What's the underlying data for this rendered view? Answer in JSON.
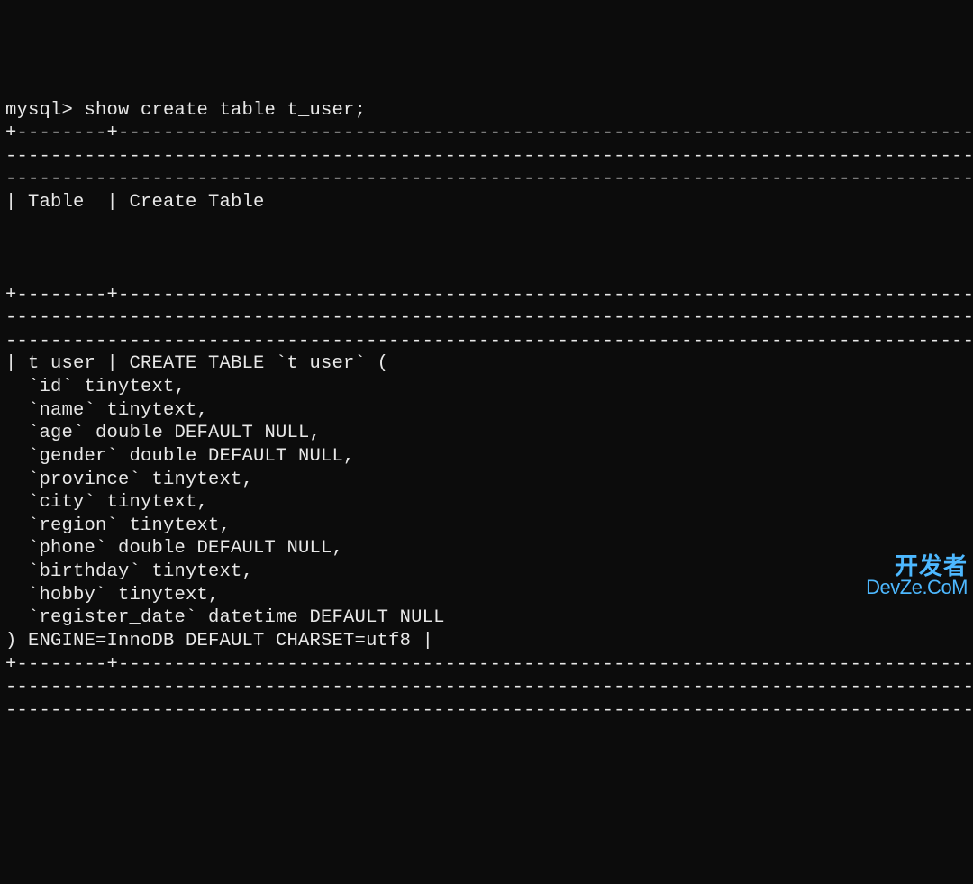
{
  "terminal": {
    "prompt": "mysql> ",
    "command": "show create table t_user;",
    "separator1": "+--------+--------------------------------------------------------------------------------------",
    "separator2": "--------------------------------------------------------------------------------------------",
    "separator3": "-----------------------------------------------------------------------------------------+",
    "header_row": "| Table  | Create Table",
    "header_end": "                                                                                         |",
    "data_line1": "| t_user | CREATE TABLE `t_user` (",
    "col_id": "  `id` tinytext,",
    "col_name": "  `name` tinytext,",
    "col_age": "  `age` double DEFAULT NULL,",
    "col_gender": "  `gender` double DEFAULT NULL,",
    "col_province": "  `province` tinytext,",
    "col_city": "  `city` tinytext,",
    "col_region": "  `region` tinytext,",
    "col_phone": "  `phone` double DEFAULT NULL,",
    "col_birthday": "  `birthday` tinytext,",
    "col_hobby": "  `hobby` tinytext,",
    "col_register": "  `register_date` datetime DEFAULT NULL",
    "data_end": ") ENGINE=InnoDB DEFAULT CHARSET=utf8 |"
  },
  "watermark": {
    "top": "开发者",
    "bottom": "DevZe.CoM"
  }
}
